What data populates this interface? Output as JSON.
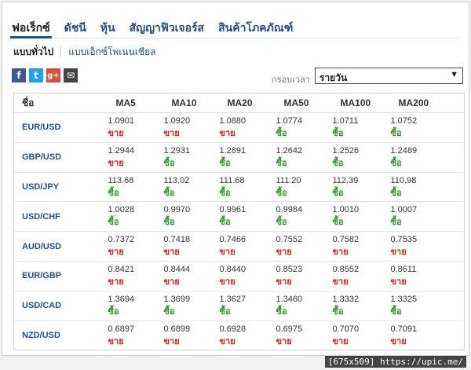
{
  "tabs": [
    "ฟอเร็กซ์",
    "ดัชนี",
    "หุ้น",
    "สัญญาฟิวเจอร์ส",
    "สินค้าโภคภัณฑ์"
  ],
  "subtabs": [
    "แบบทั่วไป",
    "แบบเอ็กซ์โพเนนเชียล"
  ],
  "share": {
    "facebook": "f",
    "twitter": "t",
    "googleplus": "g+",
    "email": "✉"
  },
  "timeframe": {
    "label": "กรอบเวลา",
    "selected": "รายวัน",
    "arrow": "▼"
  },
  "table": {
    "headers": [
      "ชื่อ",
      "MA5",
      "MA10",
      "MA20",
      "MA50",
      "MA100",
      "MA200"
    ],
    "rows": [
      {
        "pair": "EUR/USD",
        "cells": [
          {
            "v": "1.0901",
            "s": "ขาย",
            "t": "sell"
          },
          {
            "v": "1.0920",
            "s": "ขาย",
            "t": "sell"
          },
          {
            "v": "1.0880",
            "s": "ขาย",
            "t": "sell"
          },
          {
            "v": "1.0774",
            "s": "ซื้อ",
            "t": "buy"
          },
          {
            "v": "1.0711",
            "s": "ซื้อ",
            "t": "buy"
          },
          {
            "v": "1.0752",
            "s": "ซื้อ",
            "t": "buy"
          }
        ]
      },
      {
        "pair": "GBP/USD",
        "cells": [
          {
            "v": "1.2944",
            "s": "ขาย",
            "t": "sell"
          },
          {
            "v": "1.2931",
            "s": "ซื้อ",
            "t": "buy"
          },
          {
            "v": "1.2891",
            "s": "ซื้อ",
            "t": "buy"
          },
          {
            "v": "1.2642",
            "s": "ซื้อ",
            "t": "buy"
          },
          {
            "v": "1.2526",
            "s": "ซื้อ",
            "t": "buy"
          },
          {
            "v": "1.2489",
            "s": "ซื้อ",
            "t": "buy"
          }
        ]
      },
      {
        "pair": "USD/JPY",
        "cells": [
          {
            "v": "113.68",
            "s": "ซื้อ",
            "t": "buy"
          },
          {
            "v": "113.02",
            "s": "ซื้อ",
            "t": "buy"
          },
          {
            "v": "111.68",
            "s": "ซื้อ",
            "t": "buy"
          },
          {
            "v": "111.20",
            "s": "ซื้อ",
            "t": "buy"
          },
          {
            "v": "112.39",
            "s": "ซื้อ",
            "t": "buy"
          },
          {
            "v": "110.98",
            "s": "ซื้อ",
            "t": "buy"
          }
        ]
      },
      {
        "pair": "USD/CHF",
        "cells": [
          {
            "v": "1.0028",
            "s": "ซื้อ",
            "t": "buy"
          },
          {
            "v": "0.9970",
            "s": "ซื้อ",
            "t": "buy"
          },
          {
            "v": "0.9961",
            "s": "ซื้อ",
            "t": "buy"
          },
          {
            "v": "0.9984",
            "s": "ซื้อ",
            "t": "buy"
          },
          {
            "v": "1.0010",
            "s": "ซื้อ",
            "t": "buy"
          },
          {
            "v": "1.0007",
            "s": "ซื้อ",
            "t": "buy"
          }
        ]
      },
      {
        "pair": "AUD/USD",
        "cells": [
          {
            "v": "0.7372",
            "s": "ขาย",
            "t": "sell"
          },
          {
            "v": "0.7418",
            "s": "ขาย",
            "t": "sell"
          },
          {
            "v": "0.7466",
            "s": "ขาย",
            "t": "sell"
          },
          {
            "v": "0.7552",
            "s": "ขาย",
            "t": "sell"
          },
          {
            "v": "0.7582",
            "s": "ขาย",
            "t": "sell"
          },
          {
            "v": "0.7535",
            "s": "ขาย",
            "t": "sell"
          }
        ]
      },
      {
        "pair": "EUR/GBP",
        "cells": [
          {
            "v": "0.8421",
            "s": "ขาย",
            "t": "sell"
          },
          {
            "v": "0.8444",
            "s": "ขาย",
            "t": "sell"
          },
          {
            "v": "0.8440",
            "s": "ขาย",
            "t": "sell"
          },
          {
            "v": "0.8523",
            "s": "ขาย",
            "t": "sell"
          },
          {
            "v": "0.8552",
            "s": "ขาย",
            "t": "sell"
          },
          {
            "v": "0.8611",
            "s": "ขาย",
            "t": "sell"
          }
        ]
      },
      {
        "pair": "USD/CAD",
        "cells": [
          {
            "v": "1.3694",
            "s": "ซื้อ",
            "t": "buy"
          },
          {
            "v": "1.3699",
            "s": "ซื้อ",
            "t": "buy"
          },
          {
            "v": "1.3627",
            "s": "ซื้อ",
            "t": "buy"
          },
          {
            "v": "1.3460",
            "s": "ซื้อ",
            "t": "buy"
          },
          {
            "v": "1.3332",
            "s": "ซื้อ",
            "t": "buy"
          },
          {
            "v": "1.3325",
            "s": "ซื้อ",
            "t": "buy"
          }
        ]
      },
      {
        "pair": "NZD/USD",
        "cells": [
          {
            "v": "0.6897",
            "s": "ขาย",
            "t": "sell"
          },
          {
            "v": "0.6899",
            "s": "ขาย",
            "t": "sell"
          },
          {
            "v": "0.6928",
            "s": "ขาย",
            "t": "sell"
          },
          {
            "v": "0.6975",
            "s": "ขาย",
            "t": "sell"
          },
          {
            "v": "0.7070",
            "s": "ขาย",
            "t": "sell"
          },
          {
            "v": "0.7091",
            "s": "ขาย",
            "t": "sell"
          }
        ]
      }
    ]
  },
  "watermark": "[675x509] https://upic.me/",
  "colors": {
    "link": "#1f4f8f",
    "buy": "#2e9a28",
    "sell": "#e0201b"
  }
}
